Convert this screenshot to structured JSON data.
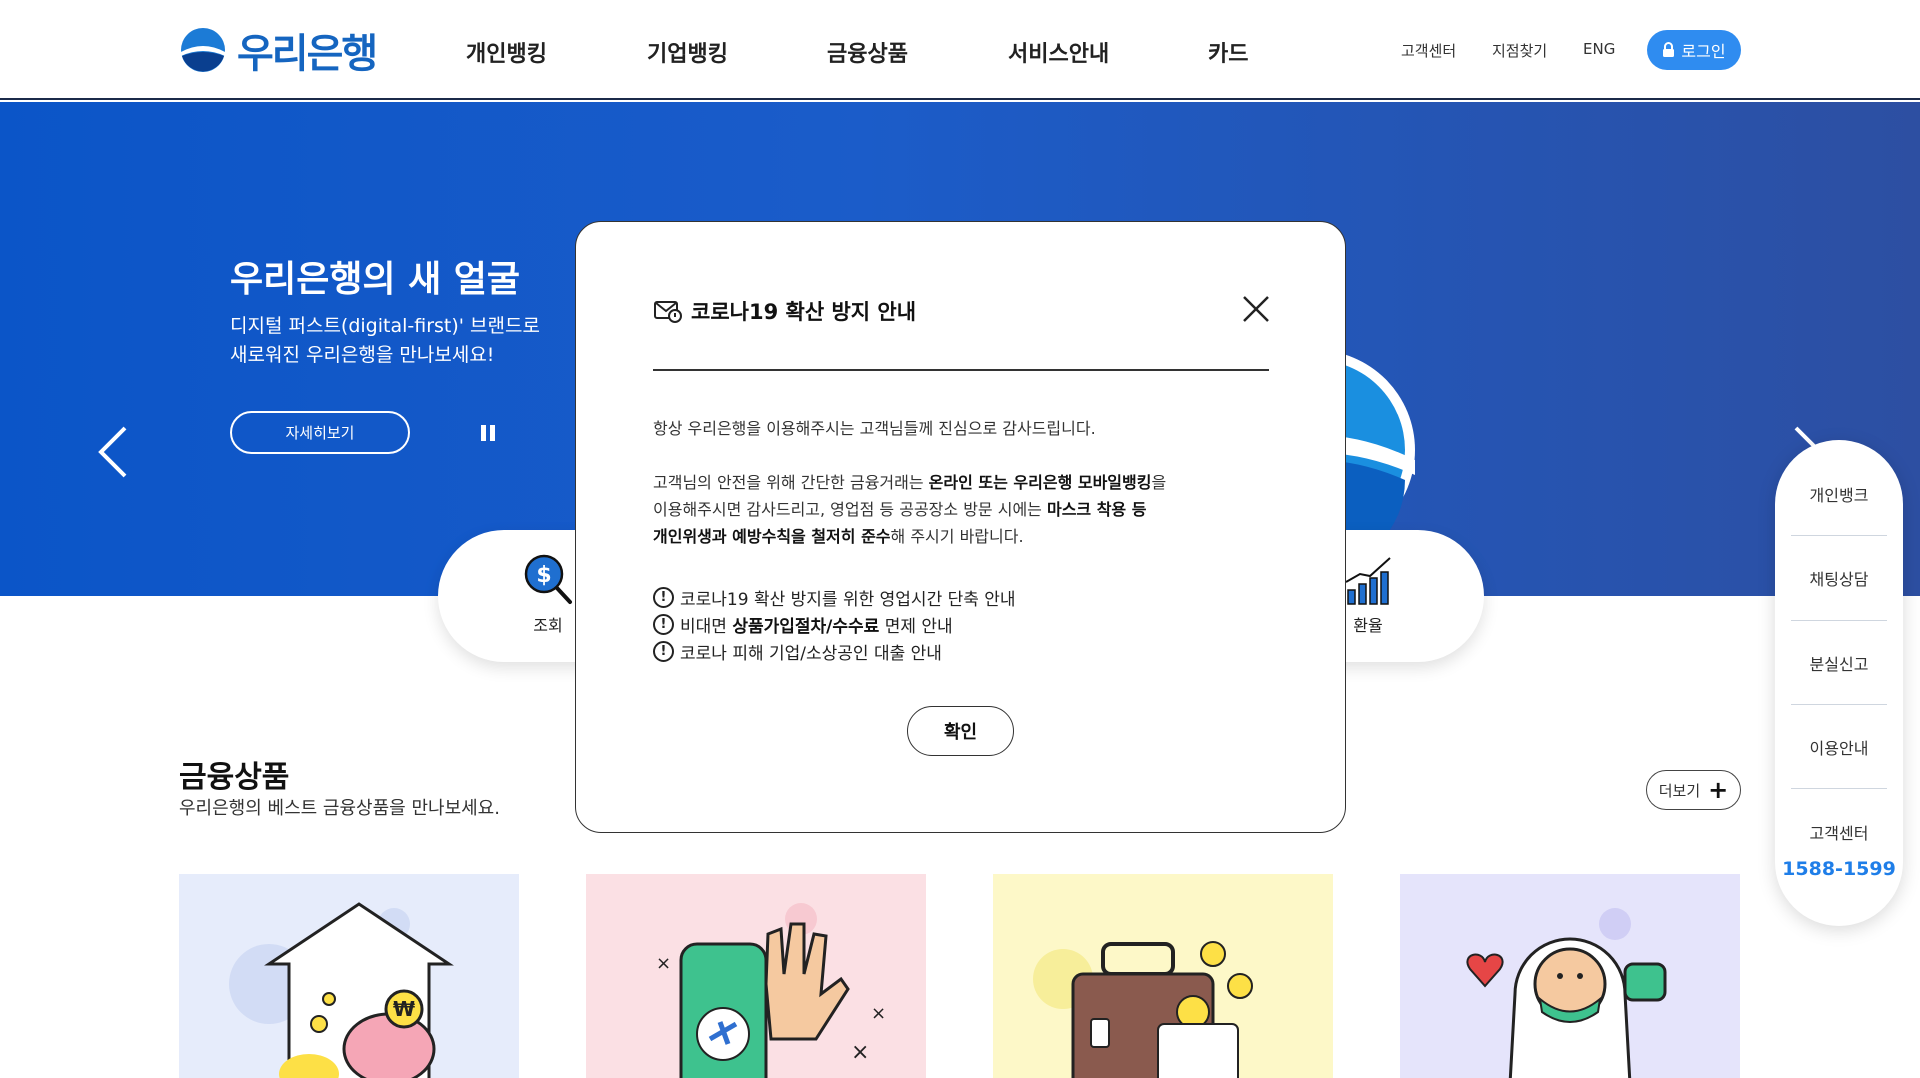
{
  "header": {
    "logo_text": "우리은행",
    "nav": [
      "개인뱅킹",
      "기업뱅킹",
      "금융상품",
      "서비스안내",
      "카드"
    ],
    "util": [
      "고객센터",
      "지점찾기",
      "ENG"
    ],
    "login_label": "로그인"
  },
  "hero": {
    "title": "우리은행의 새 얼굴",
    "desc_line1": "디지털 퍼스트(digital-first)' 브랜드로",
    "desc_line2": "새로워진 우리은행을 만나보세요!",
    "detail_button": "자세히보기"
  },
  "quick_menu": {
    "left_label": "조회",
    "right_label": "환율"
  },
  "products": {
    "title": "금융상품",
    "desc": "우리은행의 베스트 금융상품을 만나보세요.",
    "more_label": "더보기"
  },
  "side_menu": {
    "items": [
      "개인뱅크",
      "채팅상담",
      "분실신고",
      "이용안내",
      "고객센터"
    ],
    "phone": "1588-1599"
  },
  "modal": {
    "title": "코로나19 확산 방지 안내",
    "greeting": "항상 우리은행을 이용해주시는 고객님들께 진심으로 감사드립니다.",
    "body_l1_a": "고객님의 안전을 위해 간단한 금융거래는 ",
    "body_l1_b": "온라인 또는 우리은행 모바일뱅킹",
    "body_l1_c": "을",
    "body_l2_a": "이용해주시면 감사드리고, 영업점 등 공공장소 방문 시에는 ",
    "body_l2_b": "마스크 착용 등",
    "body_l3_a": "개인위생과 예방수칙을 철저히 준수",
    "body_l3_b": "해 주시기 바랍니다.",
    "notice1": "코로나19 확산 방지를 위한 영업시간 단축 안내",
    "notice2_a": "비대면 ",
    "notice2_b": "상품가입절차/수수료",
    "notice2_c": " 면제 안내",
    "notice3": "코로나 피해 기업/소상공인 대출 안내",
    "confirm_label": "확인"
  },
  "colors": {
    "brand_blue": "#1565c0",
    "login_blue": "#2f8cf0",
    "phone_blue": "#1f7ee8"
  }
}
